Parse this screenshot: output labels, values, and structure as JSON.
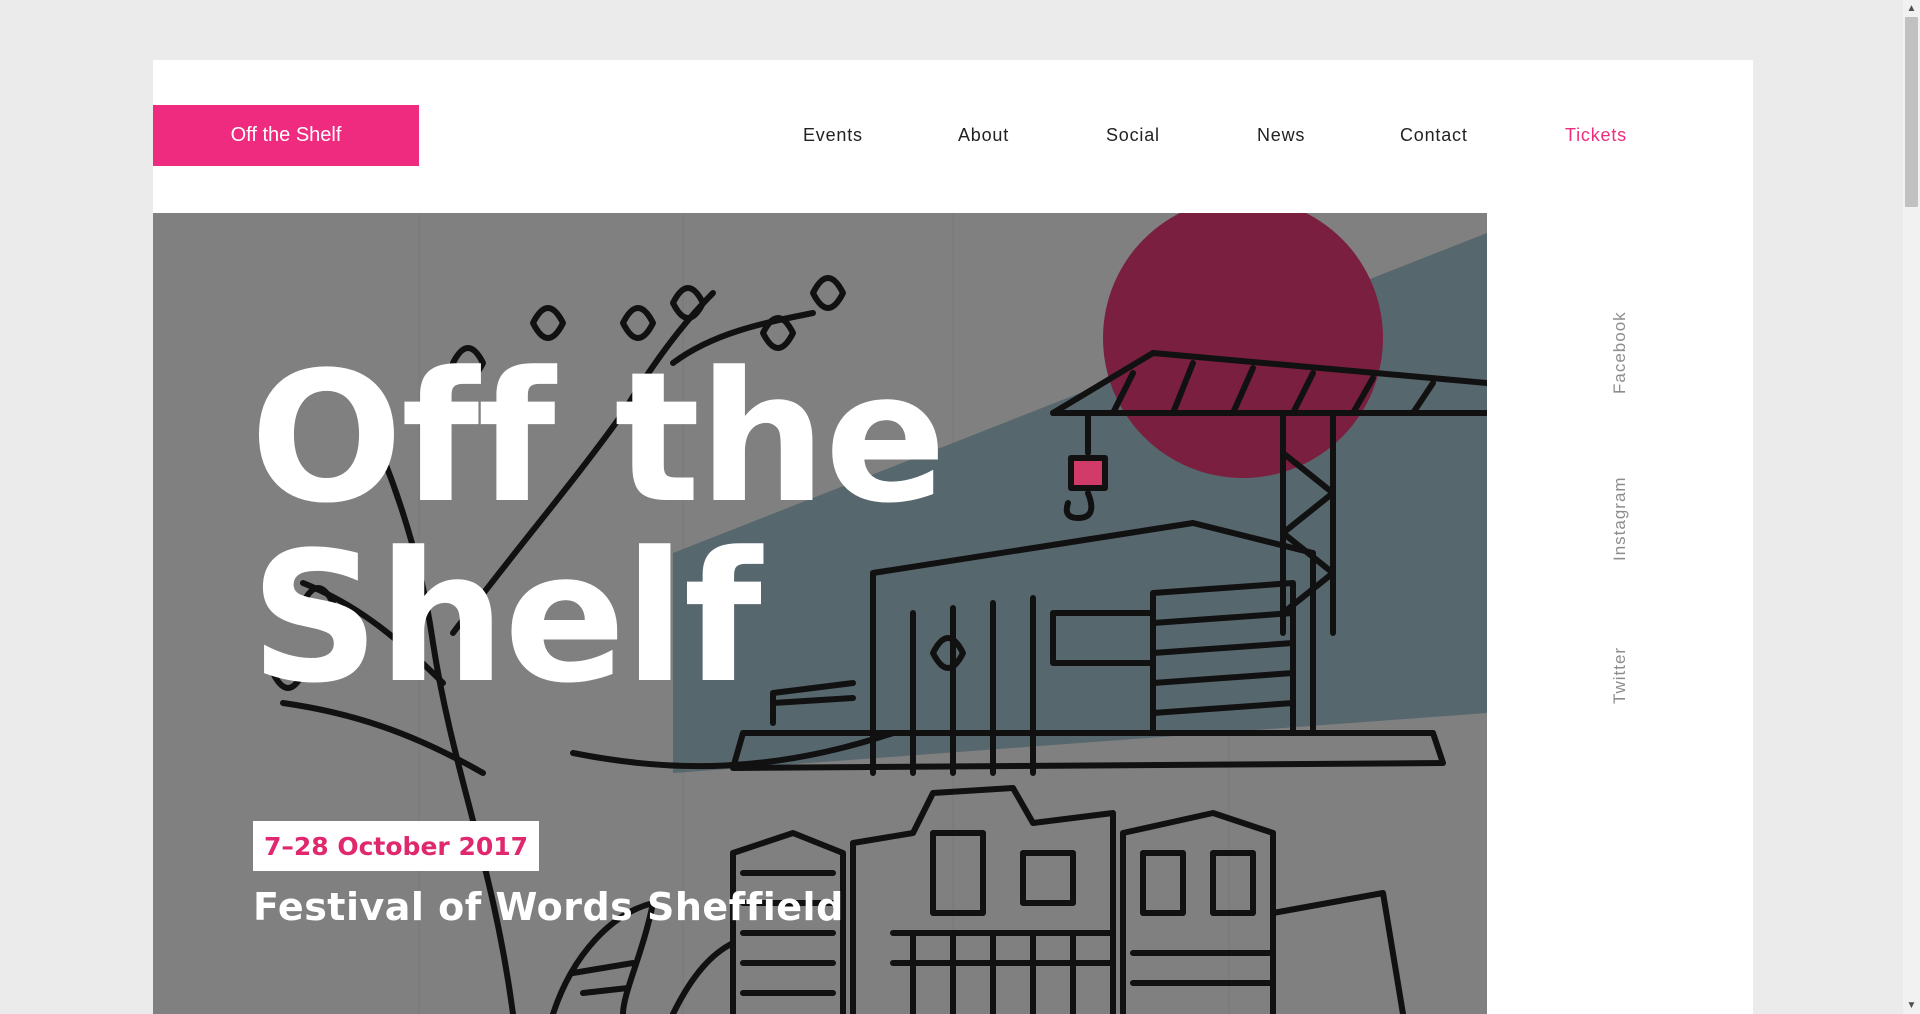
{
  "brand": {
    "logo_text": "Off the Shelf",
    "accent_color": "#ee2b7e"
  },
  "nav": {
    "items": [
      {
        "label": "Events"
      },
      {
        "label": "About"
      },
      {
        "label": "Social"
      },
      {
        "label": "News"
      },
      {
        "label": "Contact"
      },
      {
        "label": "Tickets",
        "highlighted": true
      }
    ]
  },
  "hero": {
    "title_line1": "Off the",
    "title_line2": "Shelf",
    "subtitle": "Festival of Words Sheffield",
    "date_badge": "7–28 October 2017",
    "colors": {
      "overlay": "#808080",
      "sun": "#7a1f40",
      "sky": "#57676e",
      "linework": "#111111"
    }
  },
  "social": {
    "links": [
      {
        "label": "Facebook"
      },
      {
        "label": "Instagram"
      },
      {
        "label": "Twitter"
      }
    ]
  },
  "scrollbar": {
    "up_icon": "arrow-up-icon",
    "down_icon": "arrow-down-icon"
  }
}
